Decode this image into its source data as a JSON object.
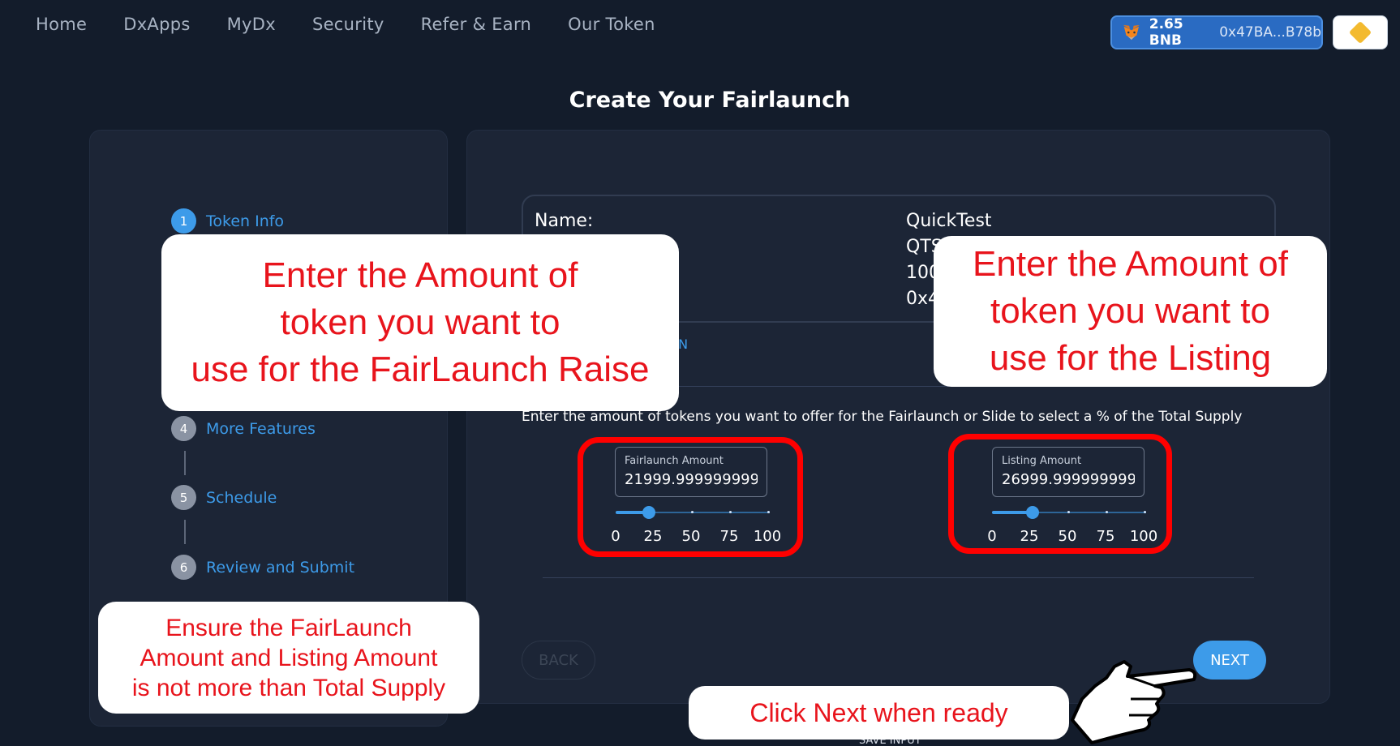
{
  "nav": {
    "items": [
      "Home",
      "DxApps",
      "MyDx",
      "Security",
      "Refer & Earn",
      "Our Token"
    ]
  },
  "wallet": {
    "balance": "2.65 BNB",
    "address": "0x47BA...B78b",
    "icon": "metamask-fox-icon"
  },
  "chain": {
    "icon": "bnb-chain-icon"
  },
  "page_title": "Create Your Fairlaunch",
  "stepper": {
    "steps": [
      {
        "num": "1",
        "label": "Token Info"
      },
      {
        "num": "4",
        "label": "More Features"
      },
      {
        "num": "5",
        "label": "Schedule"
      },
      {
        "num": "6",
        "label": "Review and Submit"
      }
    ]
  },
  "token_info": {
    "name_label": "Name:",
    "name_value": "QuickTest",
    "symbol_value": "QTS",
    "supply_value": "100",
    "address_value": "0x4",
    "partial_label": ":",
    "partial_link": "EN"
  },
  "instruction": "Enter the amount of tokens you want to offer for the Fairlaunch or Slide to select a % of the Total Supply",
  "fairlaunch": {
    "label": "Fairlaunch Amount",
    "value": "21999.999999999",
    "slider_percent": 22,
    "ticks": [
      "0",
      "25",
      "50",
      "75",
      "100"
    ]
  },
  "listing": {
    "label": "Listing Amount",
    "value": "26999.999999999",
    "slider_percent": 27,
    "ticks": [
      "0",
      "25",
      "50",
      "75",
      "100"
    ]
  },
  "buttons": {
    "back": "BACK",
    "next": "NEXT",
    "save": "SAVE INPUT"
  },
  "callouts": {
    "fairlaunch": [
      "Enter the Amount of",
      "token you want to",
      "use for the FairLaunch Raise"
    ],
    "listing": [
      "Enter the Amount of",
      "token you want to",
      "use for the Listing"
    ],
    "ensure": [
      "Ensure the FairLaunch",
      "Amount and Listing Amount",
      "is not more than Total Supply"
    ],
    "next": "Click Next when ready"
  },
  "colors": {
    "accent": "#3d9be9",
    "highlight": "#ff0000",
    "callout_text": "#e8141c"
  }
}
